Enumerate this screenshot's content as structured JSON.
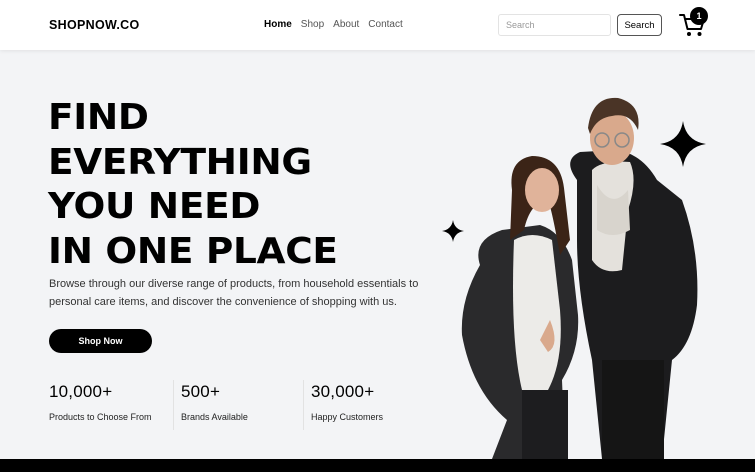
{
  "header": {
    "logo": "SHOPNOW.CO",
    "nav": [
      {
        "label": "Home",
        "active": true
      },
      {
        "label": "Shop",
        "active": false
      },
      {
        "label": "About",
        "active": false
      },
      {
        "label": "Contact",
        "active": false
      }
    ],
    "search": {
      "placeholder": "Search",
      "button_label": "Search"
    },
    "cart": {
      "icon": "cart-icon",
      "count": "1"
    }
  },
  "hero": {
    "headline": [
      "FIND",
      "EVERYTHING",
      "YOU NEED",
      "IN ONE PLACE"
    ],
    "description": "Browse through our diverse range of products, from household essentials to personal care items, and discover the convenience of shopping with us.",
    "cta_label": "Shop Now",
    "stats": [
      {
        "value": "10,000+",
        "label": "Products to Choose From"
      },
      {
        "value": "500+",
        "label": "Brands Available"
      },
      {
        "value": "30,000+",
        "label": "Happy Customers"
      }
    ],
    "image": "hero-models-photo",
    "decor_icons": [
      "sparkle-icon",
      "sparkle-icon"
    ]
  },
  "colors": {
    "accent": "#000000",
    "background": "#f3f4f6",
    "header_bg": "#ffffff"
  }
}
